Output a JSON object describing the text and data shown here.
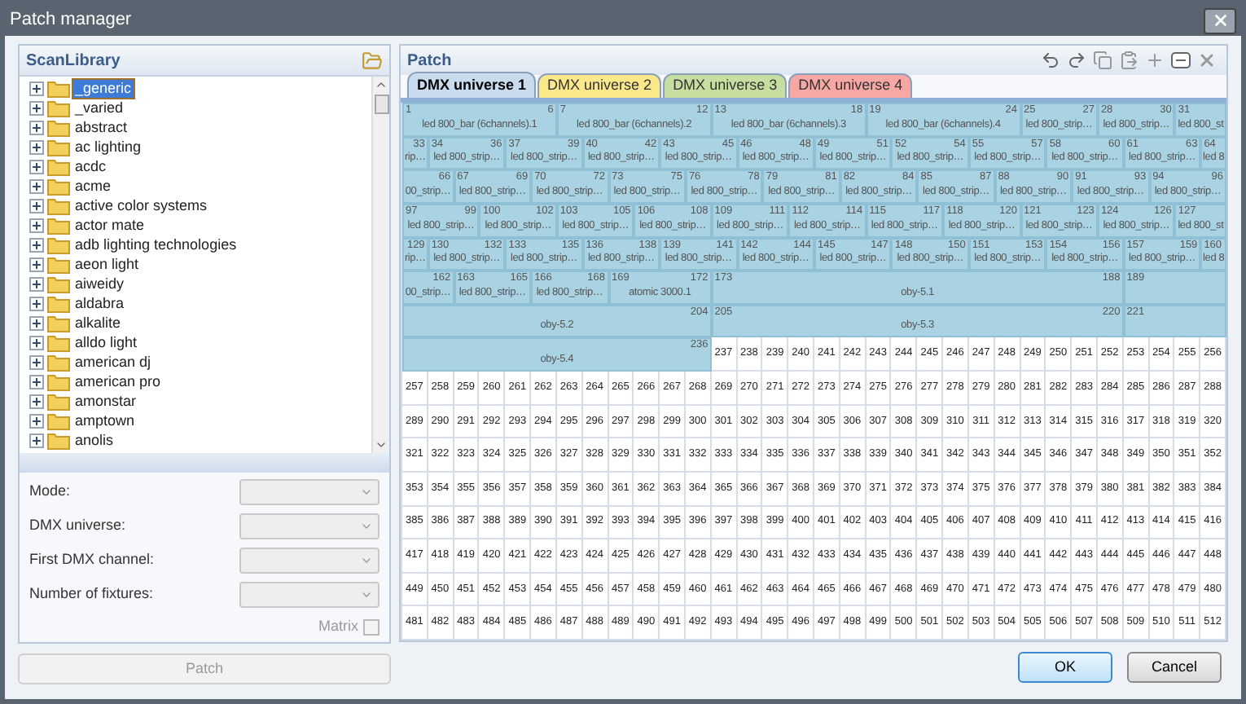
{
  "window": {
    "title": "Patch manager"
  },
  "library": {
    "title": "ScanLibrary",
    "items": [
      {
        "label": "_generic",
        "selected": true,
        "expanded": false
      },
      {
        "label": "_varied",
        "selected": false,
        "expanded": false
      },
      {
        "label": "abstract",
        "selected": false,
        "expanded": false
      },
      {
        "label": "ac lighting",
        "selected": false,
        "expanded": false
      },
      {
        "label": "acdc",
        "selected": false,
        "expanded": false
      },
      {
        "label": "acme",
        "selected": false,
        "expanded": false
      },
      {
        "label": "active color systems",
        "selected": false,
        "expanded": false
      },
      {
        "label": "actor mate",
        "selected": false,
        "expanded": false
      },
      {
        "label": "adb lighting technologies",
        "selected": false,
        "expanded": false
      },
      {
        "label": "aeon light",
        "selected": false,
        "expanded": false
      },
      {
        "label": "aiweidy",
        "selected": false,
        "expanded": false
      },
      {
        "label": "aldabra",
        "selected": false,
        "expanded": false
      },
      {
        "label": "alkalite",
        "selected": false,
        "expanded": false
      },
      {
        "label": "alldo light",
        "selected": false,
        "expanded": false
      },
      {
        "label": "american dj",
        "selected": false,
        "expanded": false
      },
      {
        "label": "american pro",
        "selected": false,
        "expanded": false
      },
      {
        "label": "amonstar",
        "selected": false,
        "expanded": false
      },
      {
        "label": "amptown",
        "selected": false,
        "expanded": false
      },
      {
        "label": "anolis",
        "selected": false,
        "expanded": false
      }
    ]
  },
  "form": {
    "fields": [
      {
        "label": "Mode:",
        "disabled": true
      },
      {
        "label": "DMX universe:",
        "disabled": true
      },
      {
        "label": "First DMX channel:",
        "disabled": true
      },
      {
        "label": "Number of fixtures:",
        "disabled": true
      }
    ],
    "matrix": {
      "label": "Matrix",
      "checked": false,
      "disabled": true
    },
    "patch_button": {
      "label": "Patch",
      "disabled": true
    }
  },
  "patch": {
    "title": "Patch",
    "tabs": [
      {
        "label": "DMX universe 1",
        "selected": true,
        "color": "#c9dcee"
      },
      {
        "label": "DMX universe 2",
        "selected": false,
        "color": "#fbe88a"
      },
      {
        "label": "DMX universe 3",
        "selected": false,
        "color": "#c6dfa0"
      },
      {
        "label": "DMX universe 4",
        "selected": false,
        "color": "#f7a8a4"
      }
    ],
    "fixtures": [
      {
        "start": "1",
        "end": "6",
        "parts": [
          {
            "label": "led 800_bar (6channels).1"
          }
        ]
      },
      {
        "start": "7",
        "end": "12",
        "parts": [
          {
            "label": "led 800_bar (6channels).2"
          }
        ]
      },
      {
        "start": "13",
        "end": "18",
        "parts": [
          {
            "label": "led 800_bar (6channels).3"
          }
        ]
      },
      {
        "start": "19",
        "end": "24",
        "parts": [
          {
            "label": "led 800_bar (6channels).4"
          }
        ]
      },
      {
        "start": "25",
        "end": "27",
        "parts": [
          {
            "label": "led 800_strip…"
          }
        ]
      },
      {
        "start": "28",
        "end": "30",
        "parts": [
          {
            "label": "led 800_strip…"
          }
        ]
      },
      {
        "start": "31",
        "end": "33",
        "parts": [
          {
            "label": "led 800_st"
          },
          {
            "label": "rip…"
          }
        ]
      },
      {
        "start": "34",
        "end": "36",
        "parts": [
          {
            "label": "led 800_strip…"
          }
        ]
      },
      {
        "start": "37",
        "end": "39",
        "parts": [
          {
            "label": "led 800_strip…"
          }
        ]
      },
      {
        "start": "40",
        "end": "42",
        "parts": [
          {
            "label": "led 800_strip…"
          }
        ]
      },
      {
        "start": "43",
        "end": "45",
        "parts": [
          {
            "label": "led 800_strip…"
          }
        ]
      },
      {
        "start": "46",
        "end": "48",
        "parts": [
          {
            "label": "led 800_strip…"
          }
        ]
      },
      {
        "start": "49",
        "end": "51",
        "parts": [
          {
            "label": "led 800_strip…"
          }
        ]
      },
      {
        "start": "52",
        "end": "54",
        "parts": [
          {
            "label": "led 800_strip…"
          }
        ]
      },
      {
        "start": "55",
        "end": "57",
        "parts": [
          {
            "label": "led 800_strip…"
          }
        ]
      },
      {
        "start": "58",
        "end": "60",
        "parts": [
          {
            "label": "led 800_strip…"
          }
        ]
      },
      {
        "start": "61",
        "end": "63",
        "parts": [
          {
            "label": "led 800_strip…"
          }
        ]
      },
      {
        "start": "64",
        "end": "66",
        "parts": [
          {
            "label": "led 8"
          },
          {
            "label": "00_strip…"
          }
        ]
      },
      {
        "start": "67",
        "end": "69",
        "parts": [
          {
            "label": "led 800_strip…"
          }
        ]
      },
      {
        "start": "70",
        "end": "72",
        "parts": [
          {
            "label": "led 800_strip…"
          }
        ]
      },
      {
        "start": "73",
        "end": "75",
        "parts": [
          {
            "label": "led 800_strip…"
          }
        ]
      },
      {
        "start": "76",
        "end": "78",
        "parts": [
          {
            "label": "led 800_strip…"
          }
        ]
      },
      {
        "start": "79",
        "end": "81",
        "parts": [
          {
            "label": "led 800_strip…"
          }
        ]
      },
      {
        "start": "82",
        "end": "84",
        "parts": [
          {
            "label": "led 800_strip…"
          }
        ]
      },
      {
        "start": "85",
        "end": "87",
        "parts": [
          {
            "label": "led 800_strip…"
          }
        ]
      },
      {
        "start": "88",
        "end": "90",
        "parts": [
          {
            "label": "led 800_strip…"
          }
        ]
      },
      {
        "start": "91",
        "end": "93",
        "parts": [
          {
            "label": "led 800_strip…"
          }
        ]
      },
      {
        "start": "94",
        "end": "96",
        "parts": [
          {
            "label": "led 800_strip…"
          }
        ]
      },
      {
        "start": "97",
        "end": "99",
        "parts": [
          {
            "label": "led 800_strip…"
          }
        ]
      },
      {
        "start": "100",
        "end": "102",
        "parts": [
          {
            "label": "led 800_strip…"
          }
        ]
      },
      {
        "start": "103",
        "end": "105",
        "parts": [
          {
            "label": "led 800_strip…"
          }
        ]
      },
      {
        "start": "106",
        "end": "108",
        "parts": [
          {
            "label": "led 800_strip…"
          }
        ]
      },
      {
        "start": "109",
        "end": "111",
        "parts": [
          {
            "label": "led 800_strip…"
          }
        ]
      },
      {
        "start": "112",
        "end": "114",
        "parts": [
          {
            "label": "led 800_strip…"
          }
        ]
      },
      {
        "start": "115",
        "end": "117",
        "parts": [
          {
            "label": "led 800_strip…"
          }
        ]
      },
      {
        "start": "118",
        "end": "120",
        "parts": [
          {
            "label": "led 800_strip…"
          }
        ]
      },
      {
        "start": "121",
        "end": "123",
        "parts": [
          {
            "label": "led 800_strip…"
          }
        ]
      },
      {
        "start": "124",
        "end": "126",
        "parts": [
          {
            "label": "led 800_strip…"
          }
        ]
      },
      {
        "start": "127",
        "end": "129",
        "parts": [
          {
            "label": "led 800_st"
          },
          {
            "label": "rip…"
          }
        ]
      },
      {
        "start": "130",
        "end": "132",
        "parts": [
          {
            "label": "led 800_strip…"
          }
        ]
      },
      {
        "start": "133",
        "end": "135",
        "parts": [
          {
            "label": "led 800_strip…"
          }
        ]
      },
      {
        "start": "136",
        "end": "138",
        "parts": [
          {
            "label": "led 800_strip…"
          }
        ]
      },
      {
        "start": "139",
        "end": "141",
        "parts": [
          {
            "label": "led 800_strip…"
          }
        ]
      },
      {
        "start": "142",
        "end": "144",
        "parts": [
          {
            "label": "led 800_strip…"
          }
        ]
      },
      {
        "start": "145",
        "end": "147",
        "parts": [
          {
            "label": "led 800_strip…"
          }
        ]
      },
      {
        "start": "148",
        "end": "150",
        "parts": [
          {
            "label": "led 800_strip…"
          }
        ]
      },
      {
        "start": "151",
        "end": "153",
        "parts": [
          {
            "label": "led 800_strip…"
          }
        ]
      },
      {
        "start": "154",
        "end": "156",
        "parts": [
          {
            "label": "led 800_strip…"
          }
        ]
      },
      {
        "start": "157",
        "end": "159",
        "parts": [
          {
            "label": "led 800_strip…"
          }
        ]
      },
      {
        "start": "160",
        "end": "162",
        "parts": [
          {
            "label": "led 8"
          },
          {
            "label": "00_strip…"
          }
        ]
      },
      {
        "start": "163",
        "end": "165",
        "parts": [
          {
            "label": "led 800_strip…"
          }
        ]
      },
      {
        "start": "166",
        "end": "168",
        "parts": [
          {
            "label": "led 800_strip…"
          }
        ]
      },
      {
        "start": "169",
        "end": "172",
        "parts": [
          {
            "label": "atomic 3000.1"
          }
        ]
      },
      {
        "start": "173",
        "end": "188",
        "parts": [
          {
            "label": "oby-5.1"
          }
        ]
      },
      {
        "start": "189",
        "end": "204",
        "parts": [
          {
            "kind": "unlabeled"
          },
          {
            "kind": "labeled",
            "label": "oby-5.2"
          }
        ]
      },
      {
        "start": "205",
        "end": "220",
        "parts": [
          {
            "label": "oby-5.3"
          }
        ]
      },
      {
        "start": "221",
        "end": "236",
        "parts": [
          {
            "kind": "unlabeled"
          },
          {
            "kind": "labeled",
            "label": "oby-5.4"
          }
        ]
      }
    ],
    "free_channels": [
      "237",
      "238",
      "239",
      "240",
      "241",
      "242",
      "243",
      "244",
      "245",
      "246",
      "247",
      "248",
      "249",
      "250",
      "251",
      "252",
      "253",
      "254",
      "255",
      "256",
      "257",
      "258",
      "259",
      "260",
      "261",
      "262",
      "263",
      "264",
      "265",
      "266",
      "267",
      "268",
      "269",
      "270",
      "271",
      "272",
      "273",
      "274",
      "275",
      "276",
      "277",
      "278",
      "279",
      "280",
      "281",
      "282",
      "283",
      "284",
      "285",
      "286",
      "287",
      "288",
      "289",
      "290",
      "291",
      "292",
      "293",
      "294",
      "295",
      "296",
      "297",
      "298",
      "299",
      "300",
      "301",
      "302",
      "303",
      "304",
      "305",
      "306",
      "307",
      "308",
      "309",
      "310",
      "311",
      "312",
      "313",
      "314",
      "315",
      "316",
      "317",
      "318",
      "319",
      "320",
      "321",
      "322",
      "323",
      "324",
      "325",
      "326",
      "327",
      "328",
      "329",
      "330",
      "331",
      "332",
      "333",
      "334",
      "335",
      "336",
      "337",
      "338",
      "339",
      "340",
      "341",
      "342",
      "343",
      "344",
      "345",
      "346",
      "347",
      "348",
      "349",
      "350",
      "351",
      "352",
      "353",
      "354",
      "355",
      "356",
      "357",
      "358",
      "359",
      "360",
      "361",
      "362",
      "363",
      "364",
      "365",
      "366",
      "367",
      "368",
      "369",
      "370",
      "371",
      "372",
      "373",
      "374",
      "375",
      "376",
      "377",
      "378",
      "379",
      "380",
      "381",
      "382",
      "383",
      "384",
      "385",
      "386",
      "387",
      "388",
      "389",
      "390",
      "391",
      "392",
      "393",
      "394",
      "395",
      "396",
      "397",
      "398",
      "399",
      "400",
      "401",
      "402",
      "403",
      "404",
      "405",
      "406",
      "407",
      "408",
      "409",
      "410",
      "411",
      "412",
      "413",
      "414",
      "415",
      "416",
      "417",
      "418",
      "419",
      "420",
      "421",
      "422",
      "423",
      "424",
      "425",
      "426",
      "427",
      "428",
      "429",
      "430",
      "431",
      "432",
      "433",
      "434",
      "435",
      "436",
      "437",
      "438",
      "439",
      "440",
      "441",
      "442",
      "443",
      "444",
      "445",
      "446",
      "447",
      "448",
      "449",
      "450",
      "451",
      "452",
      "453",
      "454",
      "455",
      "456",
      "457",
      "458",
      "459",
      "460",
      "461",
      "462",
      "463",
      "464",
      "465",
      "466",
      "467",
      "468",
      "469",
      "470",
      "471",
      "472",
      "473",
      "474",
      "475",
      "476",
      "477",
      "478",
      "479",
      "480",
      "481",
      "482",
      "483",
      "484",
      "485",
      "486",
      "487",
      "488",
      "489",
      "490",
      "491",
      "492",
      "493",
      "494",
      "495",
      "496",
      "497",
      "498",
      "499",
      "500",
      "501",
      "502",
      "503",
      "504",
      "505",
      "506",
      "507",
      "508",
      "509",
      "510",
      "511",
      "512"
    ]
  },
  "buttons": [
    {
      "label": "OK",
      "default": true
    },
    {
      "label": "Cancel",
      "default": false
    }
  ]
}
